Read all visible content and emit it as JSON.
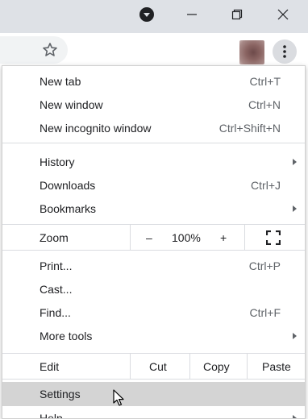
{
  "window": {
    "profile_icon": "caret-down-circle-icon",
    "minimize_icon": "minimize-icon",
    "restore_icon": "restore-icon",
    "close_icon": "close-icon"
  },
  "toolbar": {
    "bookmark_icon": "star-outline-icon",
    "avatar": "profile-avatar",
    "menu_icon": "three-dot-vertical-icon"
  },
  "menu": {
    "new_tab": {
      "label": "New tab",
      "shortcut": "Ctrl+T"
    },
    "new_window": {
      "label": "New window",
      "shortcut": "Ctrl+N"
    },
    "new_incognito": {
      "label": "New incognito window",
      "shortcut": "Ctrl+Shift+N"
    },
    "history": {
      "label": "History"
    },
    "downloads": {
      "label": "Downloads",
      "shortcut": "Ctrl+J"
    },
    "bookmarks": {
      "label": "Bookmarks"
    },
    "zoom": {
      "label": "Zoom",
      "minus": "–",
      "value": "100%",
      "plus": "+",
      "fullscreen_icon": "fullscreen-icon"
    },
    "print": {
      "label": "Print...",
      "shortcut": "Ctrl+P"
    },
    "cast": {
      "label": "Cast..."
    },
    "find": {
      "label": "Find...",
      "shortcut": "Ctrl+F"
    },
    "more_tools": {
      "label": "More tools"
    },
    "edit": {
      "label": "Edit",
      "cut": "Cut",
      "copy": "Copy",
      "paste": "Paste"
    },
    "settings": {
      "label": "Settings"
    },
    "help": {
      "label": "Help"
    }
  },
  "colors": {
    "titlebar": "#dee1e6",
    "highlight": "#d4d4d4",
    "separator": "#dadce0"
  }
}
